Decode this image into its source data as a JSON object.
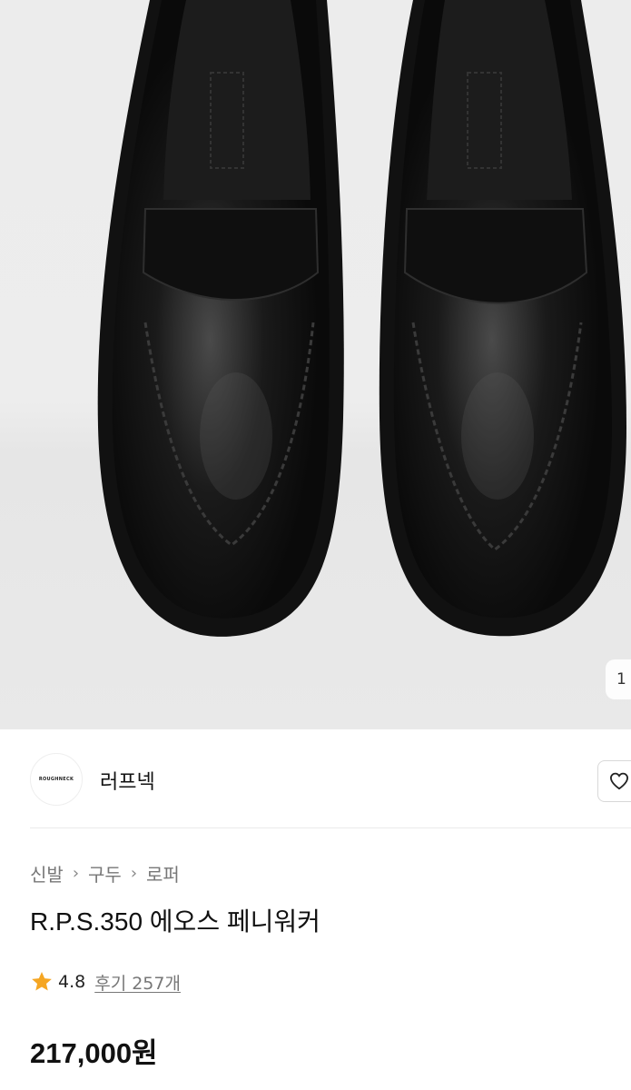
{
  "gallery": {
    "image_alt": "black penny loafers top view",
    "counter_text": "1"
  },
  "brand": {
    "logo_text": "ROUGHNECK",
    "name": "러프넥"
  },
  "breadcrumb": [
    "신발",
    "구두",
    "로퍼"
  ],
  "product": {
    "title": "R.P.S.350 에오스 페니워커",
    "rating": "4.8",
    "reviews": "후기 257개",
    "price": "217,000원"
  },
  "colors": {
    "star": "#f5a623",
    "text_primary": "#111111",
    "text_secondary": "#777777"
  },
  "icons": {
    "wishlist": "heart-outline-icon",
    "rating": "star-icon",
    "separator": "chevron-right-icon"
  }
}
